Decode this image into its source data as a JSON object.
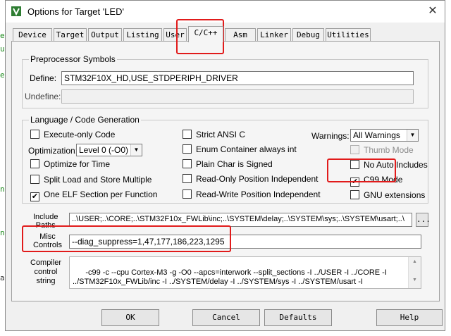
{
  "background_code": [
    "e",
    "u",
    "e",
    "n",
    "n",
    "a"
  ],
  "window": {
    "title": "Options for Target 'LED'",
    "close": "✕"
  },
  "tabs": [
    "Device",
    "Target",
    "Output",
    "Listing",
    "User",
    "C/C++",
    "Asm",
    "Linker",
    "Debug",
    "Utilities"
  ],
  "preprocessor": {
    "title": "Preprocessor Symbols",
    "define_label": "Define:",
    "define_value": "STM32F10X_HD,USE_STDPERIPH_DRIVER",
    "undefine_label": "Undefine:",
    "undefine_value": ""
  },
  "language": {
    "title": "Language / Code Generation",
    "execute_only": "Execute-only Code",
    "optimization_label": "Optimization:",
    "optimization_value": "Level 0 (-O0)",
    "optimize_time": "Optimize for Time",
    "split_load": "Split Load and Store Multiple",
    "one_elf": "One ELF Section per Function",
    "strict_ansi": "Strict ANSI C",
    "enum_container": "Enum Container always int",
    "plain_char": "Plain Char is Signed",
    "ropi": "Read-Only Position Independent",
    "rwpi": "Read-Write Position Independent",
    "warnings_label": "Warnings:",
    "warnings_value": "All Warnings",
    "thumb_mode": "Thumb Mode",
    "no_auto_includes": "No Auto Includes",
    "c99_mode": "C99 Mode",
    "gnu_extensions": "GNU extensions",
    "check": "✔"
  },
  "include_paths": {
    "label_line1": "Include",
    "label_line2": "Paths",
    "value": "..\\USER;..\\CORE;..\\STM32F10x_FWLib\\inc;..\\SYSTEM\\delay;..\\SYSTEM\\sys;..\\SYSTEM\\usart;..\\",
    "browse": "..."
  },
  "misc_controls": {
    "label_line1": "Misc",
    "label_line2": "Controls",
    "value": "--diag_suppress=1,47,177,186,223,1295"
  },
  "compiler_control": {
    "label_line1": "Compiler",
    "label_line2": "control",
    "label_line3": "string",
    "value": "-c99 -c --cpu Cortex-M3 -g -O0 --apcs=interwork --split_sections -I ../USER -I ../CORE -I\n../STM32F10x_FWLib/inc -I ../SYSTEM/delay -I ../SYSTEM/sys -I ../SYSTEM/usart -I"
  },
  "buttons": {
    "ok": "OK",
    "cancel": "Cancel",
    "defaults": "Defaults",
    "help": "Help"
  },
  "colors": {
    "highlight": "#e11b1b",
    "app_icon": "#2e7d32",
    "background_code": "#1a8a1a"
  }
}
